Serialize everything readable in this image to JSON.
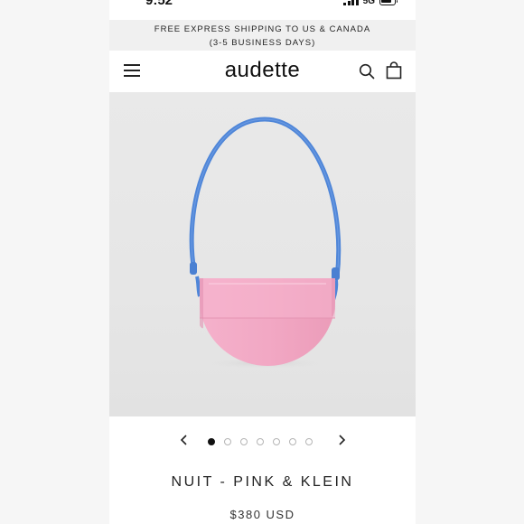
{
  "status_bar": {
    "time": "9:52",
    "network": "5G",
    "signal_bars": 4,
    "battery_level": 0.8
  },
  "promo_banner": {
    "line1": "FREE EXPRESS SHIPPING TO US & CANADA",
    "line2": "(3-5 BUSINESS DAYS)"
  },
  "header": {
    "logo": "audette",
    "icons": [
      "menu-icon",
      "search-icon",
      "shopping-bag-icon"
    ]
  },
  "product": {
    "title": "NUIT - PINK & KLEIN",
    "price": "$380 USD",
    "image_alt": "pink half-moon handbag with blue strap"
  },
  "carousel": {
    "total_images": 7,
    "active_index": 0
  },
  "colors": {
    "bag_pink": "#f2a6c2",
    "strap_blue": "#4f86d8",
    "hero_background": "#e7e7e7"
  }
}
